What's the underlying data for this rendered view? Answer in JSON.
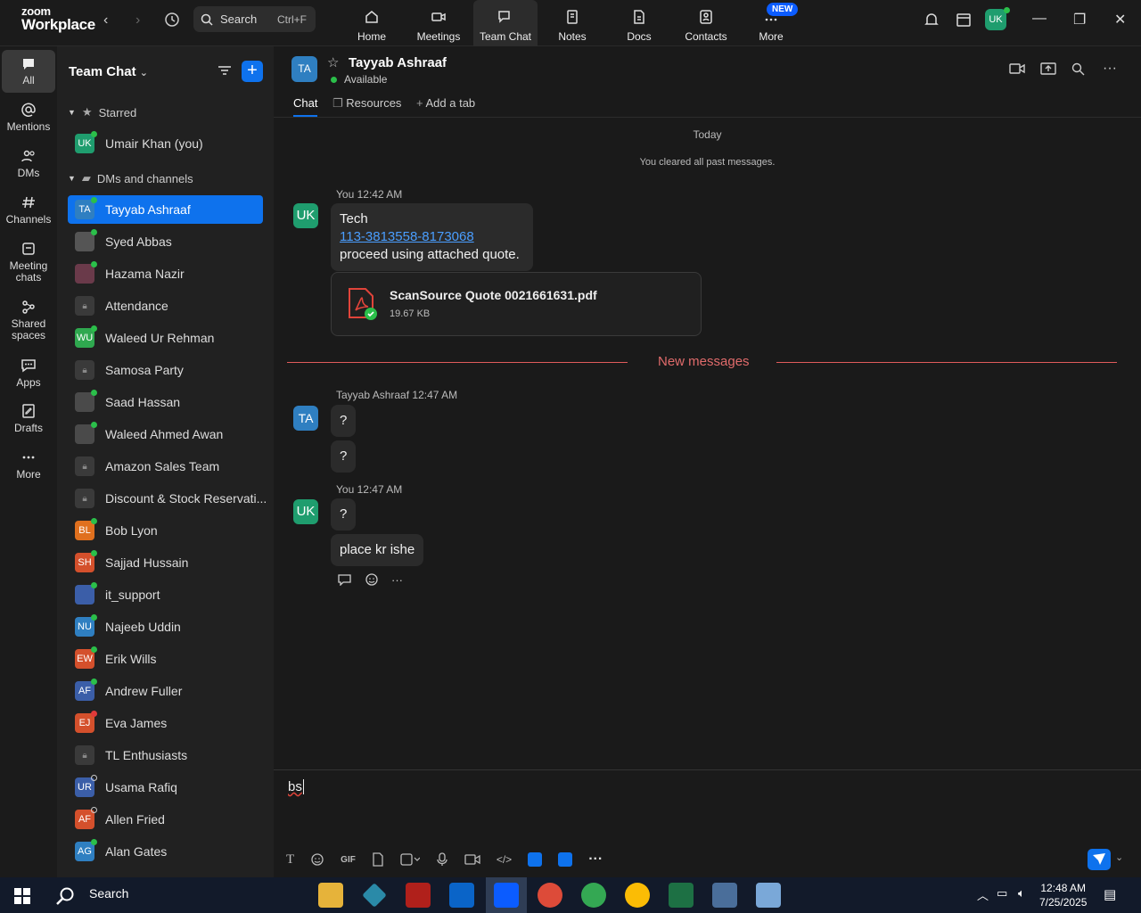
{
  "app": {
    "brand_top": "zoom",
    "brand_bottom": "Workplace"
  },
  "topbar": {
    "search_label": "Search",
    "search_shortcut": "Ctrl+F",
    "nav": [
      {
        "label": "Home",
        "icon": "home-icon"
      },
      {
        "label": "Meetings",
        "icon": "video-icon"
      },
      {
        "label": "Team Chat",
        "icon": "chat-icon"
      },
      {
        "label": "Notes",
        "icon": "notes-icon"
      },
      {
        "label": "Docs",
        "icon": "docs-icon"
      },
      {
        "label": "Contacts",
        "icon": "contacts-icon"
      },
      {
        "label": "More",
        "icon": "more-icon"
      }
    ],
    "new_badge": "NEW",
    "user_initials": "UK"
  },
  "rail": [
    {
      "label": "All"
    },
    {
      "label": "Mentions"
    },
    {
      "label": "DMs"
    },
    {
      "label": "Channels"
    },
    {
      "label": "Meeting chats"
    },
    {
      "label": "Shared spaces"
    },
    {
      "label": "Apps"
    },
    {
      "label": "Drafts"
    },
    {
      "label": "More"
    }
  ],
  "sidebar": {
    "title": "Team Chat",
    "starred_label": "Starred",
    "dms_label": "DMs and channels",
    "starred": [
      {
        "initials": "UK",
        "name": "Umair Khan (you)",
        "color": "#1f9d6e"
      }
    ],
    "items": [
      {
        "initials": "TA",
        "name": "Tayyab Ashraaf",
        "color": "#2f7fc1"
      },
      {
        "initials": "",
        "name": "Syed Abbas",
        "color": "#555555"
      },
      {
        "initials": "",
        "name": "Hazama Nazir",
        "color": "#6a3a4a"
      },
      {
        "initials": "",
        "name": "Attendance",
        "color": "#3a3a3a"
      },
      {
        "initials": "WU",
        "name": "Waleed Ur Rehman",
        "color": "#2fa84f"
      },
      {
        "initials": "",
        "name": "Samosa Party",
        "color": "#3a3a3a"
      },
      {
        "initials": "",
        "name": "Saad Hassan",
        "color": "#4a4a4a"
      },
      {
        "initials": "",
        "name": "Waleed Ahmed Awan",
        "color": "#4a4a4a"
      },
      {
        "initials": "",
        "name": "Amazon Sales Team",
        "color": "#3a3a3a"
      },
      {
        "initials": "",
        "name": "Discount & Stock Reservati...",
        "color": "#3a3a3a"
      },
      {
        "initials": "BL",
        "name": "Bob Lyon",
        "color": "#e0701e"
      },
      {
        "initials": "SH",
        "name": "Sajjad Hussain",
        "color": "#d4502c"
      },
      {
        "initials": "",
        "name": "it_support",
        "color": "#3b5ea8"
      },
      {
        "initials": "NU",
        "name": "Najeeb Uddin",
        "color": "#2f7fc1"
      },
      {
        "initials": "EW",
        "name": "Erik Wills",
        "color": "#d4502c"
      },
      {
        "initials": "AF",
        "name": "Andrew Fuller",
        "color": "#3b5ea8"
      },
      {
        "initials": "EJ",
        "name": "Eva James",
        "color": "#d4502c"
      },
      {
        "initials": "",
        "name": "TL Enthusiasts",
        "color": "#3a3a3a"
      },
      {
        "initials": "UR",
        "name": "Usama Rafiq",
        "color": "#3b5ea8"
      },
      {
        "initials": "AF",
        "name": "Allen Fried",
        "color": "#d4502c"
      },
      {
        "initials": "AG",
        "name": "Alan Gates",
        "color": "#2f7fc1"
      }
    ]
  },
  "chat": {
    "header_initials": "TA",
    "header_name": "Tayyab Ashraaf",
    "header_status": "Available",
    "tabs": [
      "Chat",
      "Resources",
      "Add a tab"
    ],
    "day_label": "Today",
    "cleared_note": "You cleared all past messages.",
    "msg1": {
      "initials": "UK",
      "sender": "You",
      "time": "12:42 AM",
      "line1": "Tech",
      "link": "113-3813558-8173068",
      "line3": "proceed using attached quote."
    },
    "file": {
      "name": "ScanSource Quote 0021661631.pdf",
      "size": "19.67 KB"
    },
    "new_messages": "New messages",
    "msg2": {
      "initials": "TA",
      "sender": "Tayyab Ashraaf",
      "time": "12:47 AM",
      "b1": "?",
      "b2": "?"
    },
    "msg3": {
      "initials": "UK",
      "sender": "You",
      "time": "12:47 AM",
      "b1": "?",
      "b2": "place kr ishe"
    },
    "composer_text": "bs"
  },
  "taskbar": {
    "search": "Search",
    "time": "12:48 AM",
    "date": "7/25/2025"
  }
}
